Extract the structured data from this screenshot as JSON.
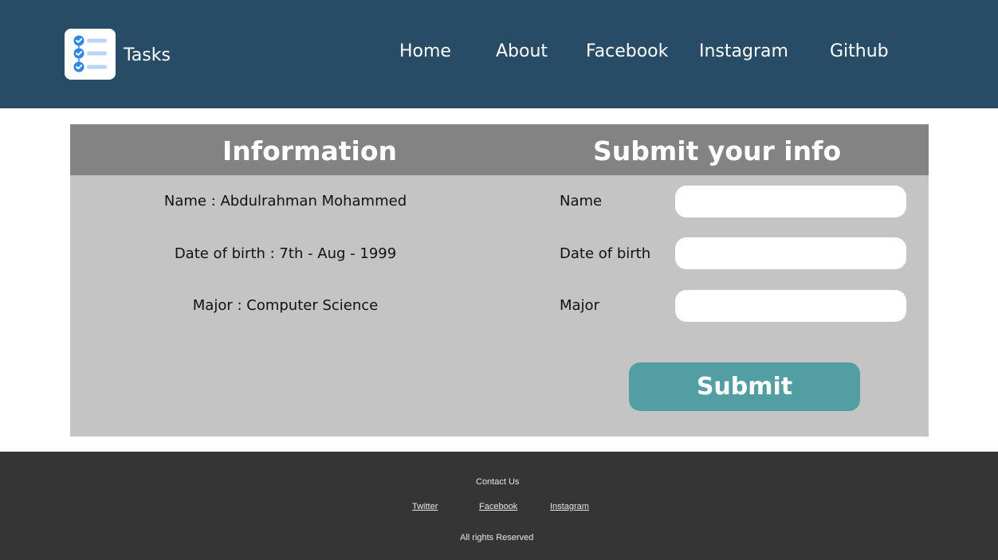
{
  "header": {
    "brand": "Tasks",
    "logo_icon": "task-list-icon",
    "nav": [
      {
        "label": "Home"
      },
      {
        "label": "About"
      },
      {
        "label": "Facebook"
      },
      {
        "label": "Instagram"
      },
      {
        "label": "Github"
      }
    ],
    "background_color": "#284c66"
  },
  "info": {
    "title": "Information",
    "name_line": "Name : Abdulrahman Mohammed",
    "dob_line": "Date of birth : 7th - Aug - 1999",
    "major_line": "Major : Computer Science"
  },
  "form": {
    "title": "Submit your info",
    "name_label": "Name",
    "name_value": "",
    "dob_label": "Date of birth",
    "dob_value": "",
    "major_label": "Major",
    "major_value": "",
    "submit_label": "Submit",
    "submit_color": "#529ea2"
  },
  "footer": {
    "contact": "Contact Us",
    "links": [
      {
        "label": "Twitter"
      },
      {
        "label": "Facebook"
      },
      {
        "label": "Instagram"
      }
    ],
    "rights": "All rights Reserved",
    "background_color": "#353535"
  }
}
